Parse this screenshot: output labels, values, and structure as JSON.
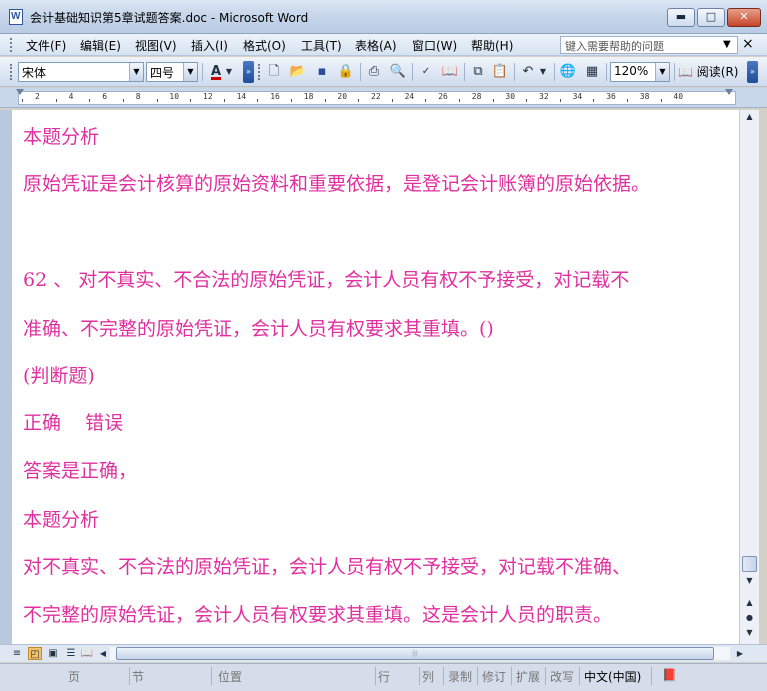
{
  "window": {
    "title": "会计基础知识第5章试题答案.doc - Microsoft Word",
    "min_label": "▬",
    "max_label": "□",
    "close_label": "✕"
  },
  "menu": {
    "items": [
      "文件(F)",
      "编辑(E)",
      "视图(V)",
      "插入(I)",
      "格式(O)",
      "工具(T)",
      "表格(A)",
      "窗口(W)",
      "帮助(H)"
    ],
    "help_placeholder": "键入需要帮助的问题",
    "close_doc": "×"
  },
  "toolbar": {
    "font": "宋体",
    "size": "四号",
    "zoom": "120%",
    "read_label": "阅读(R)",
    "font_color_icon": "A"
  },
  "ruler": {
    "labels": [
      "2",
      "4",
      "6",
      "8",
      "10",
      "12",
      "14",
      "16",
      "18",
      "20",
      "22",
      "24",
      "26",
      "28",
      "30",
      "32",
      "34",
      "36",
      "38",
      "40"
    ]
  },
  "document": {
    "lines": [
      "本题分析",
      "原始凭证是会计核算的原始资料和重要依据，是登记会计账簿的原始依据。",
      "62 、  对不真实、不合法的原始凭证，会计人员有权不予接受，对记载不",
      "准确、不完整的原始凭证，会计人员有权要求其重填。()",
      "(判断题)",
      "正确    错误",
      "答案是正确，",
      "本题分析",
      "对不真实、不合法的原始凭证，会计人员有权不予接受，对记载不准确、",
      "不完整的原始凭证，会计人员有权要求其重填。这是会计人员的职责。"
    ]
  },
  "statusbar": {
    "page": "页",
    "section": "节",
    "position": "位置",
    "line": "行",
    "col": "列",
    "rec": "录制",
    "trk": "修订",
    "ext": "扩展",
    "ovr": "改写",
    "lang": "中文(中国)"
  }
}
